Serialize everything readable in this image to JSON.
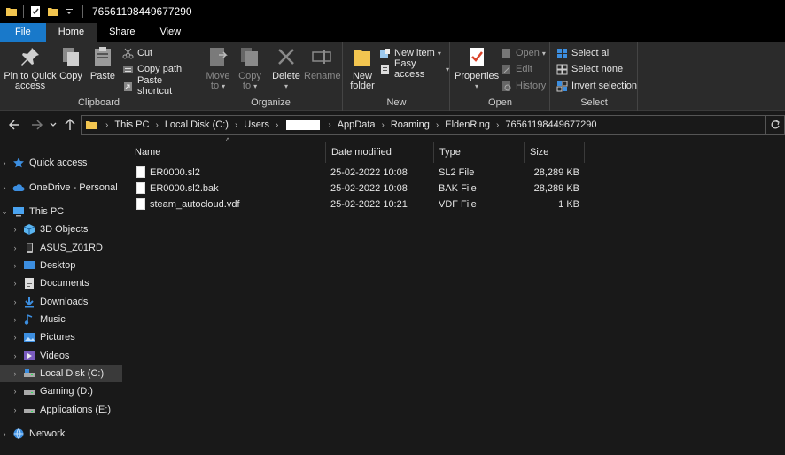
{
  "window": {
    "title": "76561198449677290"
  },
  "tabs": [
    {
      "label": "File"
    },
    {
      "label": "Home"
    },
    {
      "label": "Share"
    },
    {
      "label": "View"
    }
  ],
  "ribbon": {
    "clipboard": {
      "label": "Clipboard",
      "pin": "Pin to Quick\naccess",
      "pin_line1": "Pin to Quick",
      "pin_line2": "access",
      "copy": "Copy",
      "paste": "Paste",
      "cut": "Cut",
      "copy_path": "Copy path",
      "paste_shortcut": "Paste shortcut"
    },
    "organize": {
      "label": "Organize",
      "move_to_line1": "Move",
      "move_to_line2": "to",
      "copy_to_line1": "Copy",
      "copy_to_line2": "to",
      "delete": "Delete",
      "rename": "Rename"
    },
    "new": {
      "label": "New",
      "new_folder_line1": "New",
      "new_folder_line2": "folder",
      "new_item": "New item",
      "easy_access": "Easy access"
    },
    "open": {
      "label": "Open",
      "properties": "Properties",
      "open": "Open",
      "edit": "Edit",
      "history": "History"
    },
    "select": {
      "label": "Select",
      "select_all": "Select all",
      "select_none": "Select none",
      "invert": "Invert selection"
    }
  },
  "address": {
    "crumbs": [
      "This PC",
      "Local Disk (C:)",
      "Users",
      "",
      "AppData",
      "Roaming",
      "EldenRing",
      "76561198449677290"
    ]
  },
  "sidebar": {
    "items": [
      {
        "label": "Quick access",
        "icon": "star-icon"
      },
      {
        "label": "OneDrive - Personal",
        "icon": "cloud-icon"
      },
      {
        "label": "This PC",
        "icon": "computer-icon"
      },
      {
        "label": "3D Objects",
        "icon": "cube-icon"
      },
      {
        "label": "ASUS_Z01RD",
        "icon": "phone-icon"
      },
      {
        "label": "Desktop",
        "icon": "desktop-icon"
      },
      {
        "label": "Documents",
        "icon": "document-icon"
      },
      {
        "label": "Downloads",
        "icon": "download-icon"
      },
      {
        "label": "Music",
        "icon": "music-icon"
      },
      {
        "label": "Pictures",
        "icon": "picture-icon"
      },
      {
        "label": "Videos",
        "icon": "video-icon"
      },
      {
        "label": "Local Disk (C:)",
        "icon": "drive-icon"
      },
      {
        "label": "Gaming (D:)",
        "icon": "drive-icon"
      },
      {
        "label": "Applications (E:)",
        "icon": "drive-icon"
      },
      {
        "label": "Network",
        "icon": "network-icon"
      }
    ]
  },
  "list": {
    "columns": [
      "Name",
      "Date modified",
      "Type",
      "Size"
    ],
    "sort_indicator": "^",
    "rows": [
      {
        "name": "ER0000.sl2",
        "date": "25-02-2022 10:08",
        "type": "SL2 File",
        "size": "28,289 KB"
      },
      {
        "name": "ER0000.sl2.bak",
        "date": "25-02-2022 10:08",
        "type": "BAK File",
        "size": "28,289 KB"
      },
      {
        "name": "steam_autocloud.vdf",
        "date": "25-02-2022 10:21",
        "type": "VDF File",
        "size": "1 KB"
      }
    ]
  },
  "colors": {
    "accent": "#1979ca",
    "folder": "#f2c550",
    "background": "#191919",
    "ribbon": "#2b2b2b"
  }
}
